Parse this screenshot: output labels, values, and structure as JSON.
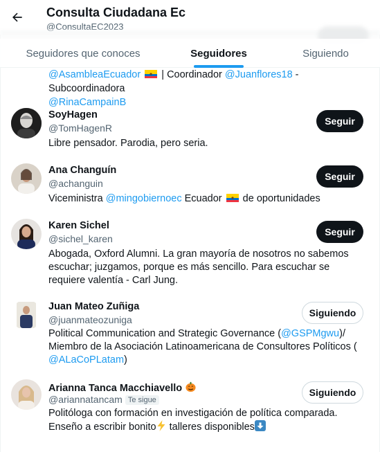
{
  "header": {
    "title": "Consulta Ciudadana Ec",
    "handle": "@ConsultaEC2023"
  },
  "tabs": [
    {
      "label": "Seguidores que conoces",
      "active": false
    },
    {
      "label": "Seguidores",
      "active": true
    },
    {
      "label": "Siguiendo",
      "active": false
    }
  ],
  "partial_bio": {
    "link1": "@AsambleaEcuador",
    "text1": " | Coordinador ",
    "link2": "@Juanflores18",
    "text2": " - Subcoordinadora",
    "link3": "@RinaCampainB"
  },
  "users": [
    {
      "name": "SoyHagen",
      "handle": "@TomHagenR",
      "button": "Seguir",
      "bio": "Libre pensador. Parodia, pero seria."
    },
    {
      "name": "Ana Changuín",
      "handle": "@achanguin",
      "button": "Seguir",
      "bio_pre": "Viceministra ",
      "bio_link": "@mingobiernoec",
      "bio_mid": " Ecuador ",
      "bio_post": " de oportunidades"
    },
    {
      "name": "Karen Sichel",
      "handle": "@sichel_karen",
      "button": "Seguir",
      "bio": "Abogada, Oxford Alumni. La gran mayoría de nosotros no sabemos escuchar; juzgamos, porque es más sencillo. Para escuchar se requiere valentía - Carl Jung."
    },
    {
      "name": "Juan Mateo Zuñiga",
      "handle": "@juanmateozuniga",
      "button": "Siguiendo",
      "bio_pre": "Political Communication and Strategic Governance (",
      "bio_link1": "@GSPMgwu",
      "bio_mid": ")/ Miembro de la Asociación Latinoamericana de Consultores Políticos (",
      "bio_link2": "@ALaCoPLatam",
      "bio_post": ")"
    },
    {
      "name": "Arianna Tanca Macchiavello",
      "handle": "@ariannatancam",
      "badge": "Te sigue",
      "button": "Siguiendo",
      "bio_pre": "Politóloga con formación en investigación de política comparada. Enseño a escribir bonito",
      "bio_mid": " talleres disponibles",
      "icons": [
        "pumpkin-emoji",
        "lightning-emoji",
        "down-arrow-emoji"
      ]
    }
  ],
  "colors": {
    "link": "#1d9bf0",
    "follow_bg": "#0f1419",
    "secondary_text": "#536471"
  }
}
